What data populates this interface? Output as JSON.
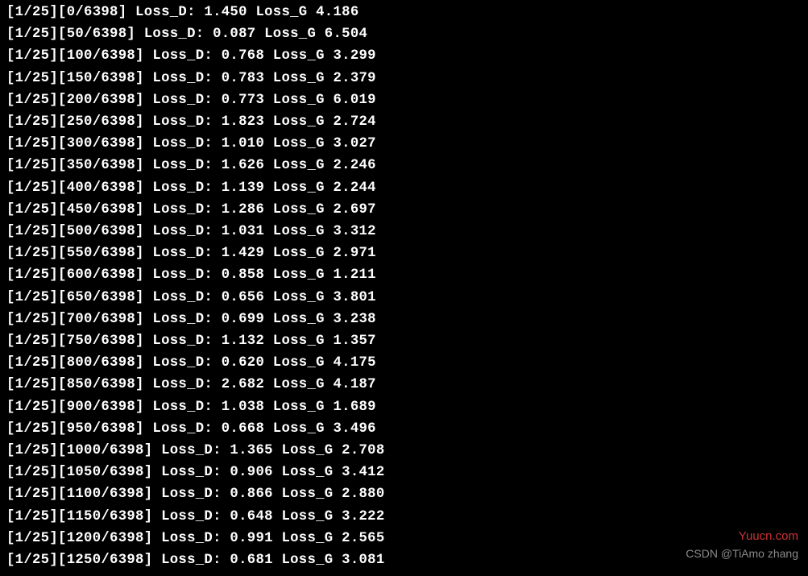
{
  "training": {
    "epoch_current": 1,
    "epoch_total": 25,
    "total_batches": 6398,
    "logs": [
      {
        "batch": 0,
        "loss_d": "1.450",
        "loss_g": "4.186"
      },
      {
        "batch": 50,
        "loss_d": "0.087",
        "loss_g": "6.504"
      },
      {
        "batch": 100,
        "loss_d": "0.768",
        "loss_g": "3.299"
      },
      {
        "batch": 150,
        "loss_d": "0.783",
        "loss_g": "2.379"
      },
      {
        "batch": 200,
        "loss_d": "0.773",
        "loss_g": "6.019"
      },
      {
        "batch": 250,
        "loss_d": "1.823",
        "loss_g": "2.724"
      },
      {
        "batch": 300,
        "loss_d": "1.010",
        "loss_g": "3.027"
      },
      {
        "batch": 350,
        "loss_d": "1.626",
        "loss_g": "2.246"
      },
      {
        "batch": 400,
        "loss_d": "1.139",
        "loss_g": "2.244"
      },
      {
        "batch": 450,
        "loss_d": "1.286",
        "loss_g": "2.697"
      },
      {
        "batch": 500,
        "loss_d": "1.031",
        "loss_g": "3.312"
      },
      {
        "batch": 550,
        "loss_d": "1.429",
        "loss_g": "2.971"
      },
      {
        "batch": 600,
        "loss_d": "0.858",
        "loss_g": "1.211"
      },
      {
        "batch": 650,
        "loss_d": "0.656",
        "loss_g": "3.801"
      },
      {
        "batch": 700,
        "loss_d": "0.699",
        "loss_g": "3.238"
      },
      {
        "batch": 750,
        "loss_d": "1.132",
        "loss_g": "1.357"
      },
      {
        "batch": 800,
        "loss_d": "0.620",
        "loss_g": "4.175"
      },
      {
        "batch": 850,
        "loss_d": "2.682",
        "loss_g": "4.187"
      },
      {
        "batch": 900,
        "loss_d": "1.038",
        "loss_g": "1.689"
      },
      {
        "batch": 950,
        "loss_d": "0.668",
        "loss_g": "3.496"
      },
      {
        "batch": 1000,
        "loss_d": "1.365",
        "loss_g": "2.708"
      },
      {
        "batch": 1050,
        "loss_d": "0.906",
        "loss_g": "3.412"
      },
      {
        "batch": 1100,
        "loss_d": "0.866",
        "loss_g": "2.880"
      },
      {
        "batch": 1150,
        "loss_d": "0.648",
        "loss_g": "3.222"
      },
      {
        "batch": 1200,
        "loss_d": "0.991",
        "loss_g": "2.565"
      },
      {
        "batch": 1250,
        "loss_d": "0.681",
        "loss_g": "3.081"
      }
    ]
  },
  "labels": {
    "loss_d": "Loss_D:",
    "loss_g": "Loss_G"
  },
  "watermarks": {
    "site": "Yuucn.com",
    "author": "CSDN @TiAmo zhang"
  }
}
